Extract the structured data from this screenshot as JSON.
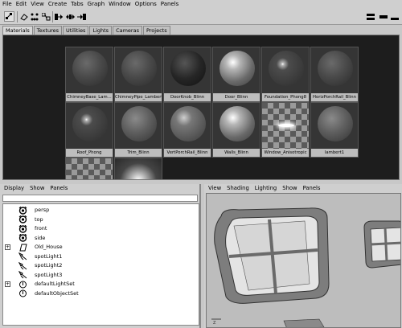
{
  "menubar": [
    "File",
    "Edit",
    "View",
    "Create",
    "Tabs",
    "Graph",
    "Window",
    "Options",
    "Panels"
  ],
  "tabs": [
    "Materials",
    "Textures",
    "Utilities",
    "Lights",
    "Cameras",
    "Projects"
  ],
  "materials": [
    {
      "label": "ChimneyBase_Lam...",
      "shade": "lambert_dark"
    },
    {
      "label": "ChimneyPipe_Lambert",
      "shade": "lambert_dark"
    },
    {
      "label": "DoorKnob_Blinn",
      "shade": "blinn_dark"
    },
    {
      "label": "Door_Blinn",
      "shade": "blinn_light"
    },
    {
      "label": "Foundation_Phong8",
      "shade": "phong_dark"
    },
    {
      "label": "HorizPorchRail_Blinn",
      "shade": "lambert_dark"
    },
    {
      "label": "Roof_Phong",
      "shade": "phong_dark"
    },
    {
      "label": "Trim_Blinn",
      "shade": "lambert_mid"
    },
    {
      "label": "VertPorchRail_Blinn",
      "shade": "blinn_mid"
    },
    {
      "label": "Walls_Blinn",
      "shade": "blinn_light"
    },
    {
      "label": "Window_Anisotropic",
      "shade": "checker"
    },
    {
      "label": "lambert1",
      "shade": "lambert_mid"
    }
  ],
  "partial_row": [
    {
      "shade": "checker"
    },
    {
      "shade": "glow"
    }
  ],
  "outliner": {
    "menu": [
      "Display",
      "Show",
      "Panels"
    ],
    "items": [
      {
        "label": "persp",
        "icon": "camera-icon",
        "expandable": false
      },
      {
        "label": "top",
        "icon": "camera-icon",
        "expandable": false
      },
      {
        "label": "front",
        "icon": "camera-icon",
        "expandable": false
      },
      {
        "label": "side",
        "icon": "camera-icon",
        "expandable": false
      },
      {
        "label": "Old_House",
        "icon": "transform-icon",
        "expandable": true
      },
      {
        "label": "spotLight1",
        "icon": "spotlight-icon",
        "expandable": false
      },
      {
        "label": "spotLight2",
        "icon": "spotlight-icon",
        "expandable": false
      },
      {
        "label": "spotLight3",
        "icon": "spotlight-icon",
        "expandable": false
      },
      {
        "label": "defaultLightSet",
        "icon": "set-icon",
        "expandable": true
      },
      {
        "label": "defaultObjectSet",
        "icon": "set-icon",
        "expandable": false
      }
    ]
  },
  "viewport": {
    "menu": [
      "View",
      "Shading",
      "Lighting",
      "Show",
      "Panels"
    ]
  }
}
